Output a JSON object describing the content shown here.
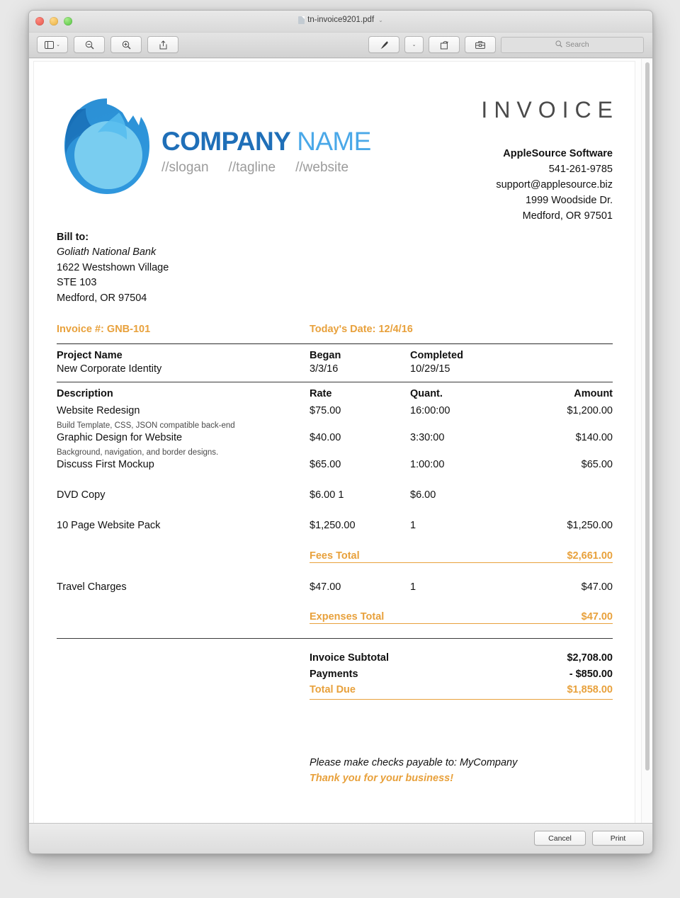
{
  "window": {
    "document_title": "tn-invoice9201.pdf",
    "title_chevron": "⌄",
    "traffic_lights": [
      "close",
      "minimize",
      "zoom"
    ]
  },
  "toolbar": {
    "sidebar_button": "sidebar-view",
    "sidebar_chevron": "⌄",
    "zoom_out_button": "zoom-out",
    "zoom_in_button": "zoom-in",
    "share_button": "share",
    "markup_button": "markup-pen",
    "markup_chevron": "⌄",
    "rotate_button": "rotate",
    "annotate_button": "annotate",
    "search": {
      "placeholder": "Search",
      "value": "",
      "icon": "search-icon"
    }
  },
  "invoice": {
    "brand": {
      "name_part1": "COMPANY",
      "name_part2": "NAME",
      "slogan": "//slogan",
      "tagline": "//tagline",
      "website": "//website",
      "color_dark": "#1f6fb8",
      "color_light": "#4aa8e8"
    },
    "title": "INVOICE",
    "vendor": {
      "name": "AppleSource Software",
      "phone": "541-261-9785",
      "email": "support@applesource.biz",
      "street": "1999 Woodside Dr.",
      "city_state_zip": "Medford, OR 97501"
    },
    "bill_to": {
      "label": "Bill to:",
      "company": "Goliath National Bank",
      "street": "1622 Westshown Village",
      "suite": "STE 103",
      "city_state_zip": "Medford, OR 97504"
    },
    "meta": {
      "invoice_label": "Invoice #:",
      "invoice_number": "GNB-101",
      "date_label": "Today's Date:",
      "date_value": "12/4/16",
      "accent_color": "#e8a13c"
    },
    "project": {
      "headers": {
        "name": "Project Name",
        "began": "Began",
        "completed": "Completed"
      },
      "values": {
        "name": "New Corporate Identity",
        "began": "3/3/16",
        "completed": "10/29/15"
      }
    },
    "table": {
      "headers": {
        "description": "Description",
        "rate": "Rate",
        "quantity": "Quant.",
        "amount": "Amount"
      },
      "rows": [
        {
          "description": "Website Redesign",
          "rate": "$75.00",
          "quantity": "16:00:00",
          "amount": "$1,200.00",
          "note": "Build Template, CSS, JSON compatible back-end"
        },
        {
          "description": "Graphic Design for Website",
          "rate": "$40.00",
          "quantity": "3:30:00",
          "amount": "$140.00",
          "note": "Background, navigation, and border designs."
        },
        {
          "description": "Discuss First Mockup",
          "rate": "$65.00",
          "quantity": "1:00:00",
          "amount": "$65.00",
          "note": ""
        },
        {
          "description": "DVD Copy",
          "rate": "$6.00 1",
          "quantity": "$6.00",
          "amount": "",
          "note": ""
        },
        {
          "description": "10 Page Website Pack",
          "rate": "$1,250.00",
          "quantity": "1",
          "amount": "$1,250.00",
          "note": ""
        }
      ],
      "fees_total_label": "Fees Total",
      "fees_total_value": "$2,661.00",
      "expense_rows": [
        {
          "description": "Travel Charges",
          "rate": "$47.00",
          "quantity": "1",
          "amount": "$47.00"
        }
      ],
      "expenses_total_label": "Expenses Total",
      "expenses_total_value": "$47.00"
    },
    "totals": {
      "subtotal_label": "Invoice Subtotal",
      "subtotal_value": "$2,708.00",
      "payments_label": "Payments",
      "payments_value": "- $850.00",
      "due_label": "Total Due",
      "due_value": "$1,858.00"
    },
    "footer": {
      "checks_note": "Please make checks payable to: MyCompany",
      "thanks": "Thank you for your business!"
    }
  },
  "bottom_bar": {
    "cancel_label": "Cancel",
    "print_label": "Print"
  }
}
